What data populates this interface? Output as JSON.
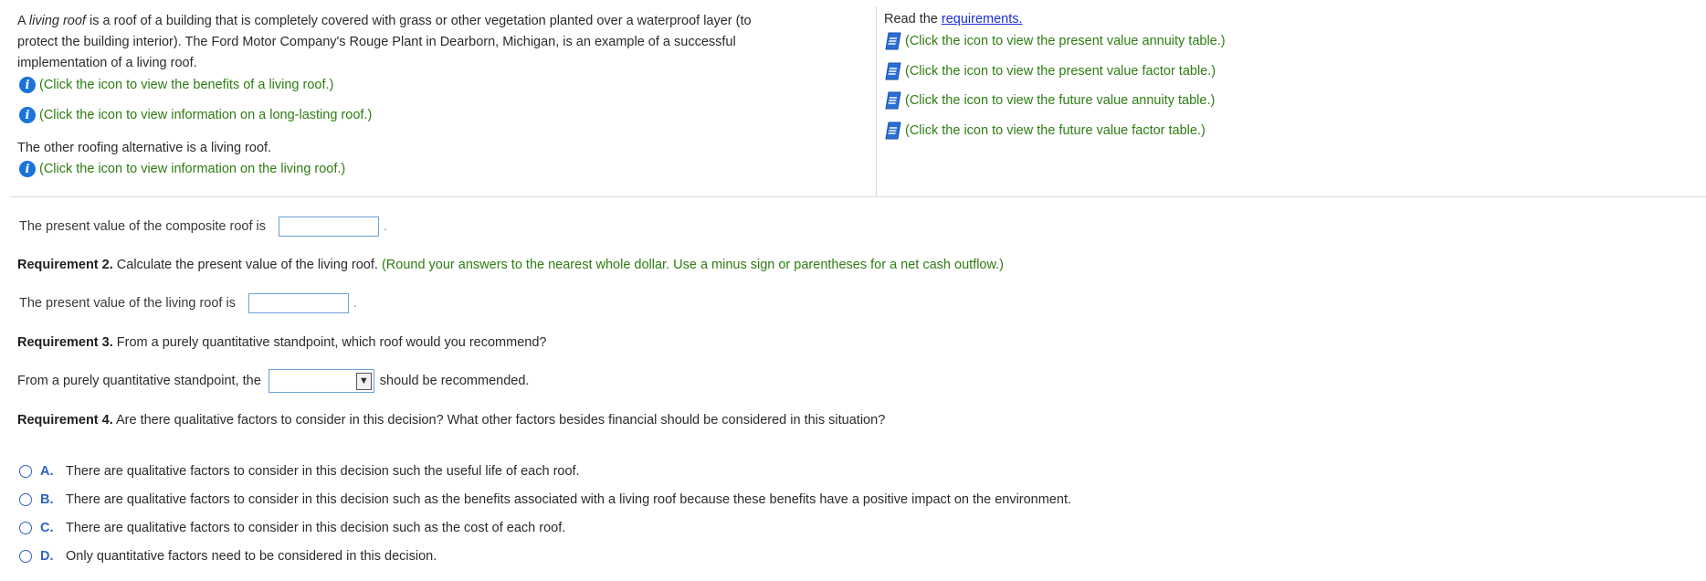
{
  "intro": {
    "prefix": "A ",
    "term": "living roof",
    "line1_rest": " is a roof of a building that is completely covered with grass or other vegetation planted over a waterproof layer (to",
    "line2": "protect the building interior). The Ford Motor Company's Rouge Plant in Dearborn, Michigan, is an example of a successful",
    "line3": "implementation of a living roof."
  },
  "info_links": [
    "(Click the icon to view the benefits of a living roof.)",
    "(Click the icon to view information on a long-lasting roof.)"
  ],
  "alternative_text": "The other roofing alternative is a living roof.",
  "living_roof_link": "(Click the icon to view information on the living roof.)",
  "right": {
    "read_prefix": "Read the ",
    "requirements_link": "requirements.",
    "tables": [
      "(Click the icon to view the present value annuity table.)",
      "(Click the icon to view the present value factor table.)",
      "(Click the icon to view the future value annuity table.)",
      "(Click the icon to view the future value factor table.)"
    ]
  },
  "q1": {
    "label": "The present value of the composite roof is",
    "value": "",
    "suffix": "."
  },
  "req2": {
    "bold": "Requirement 2.",
    "text": " Calculate the present value of the living roof. ",
    "hint": "(Round your answers to the nearest whole dollar. Use a minus sign or parentheses for a net cash outflow.)"
  },
  "q2": {
    "label": "The present value of the living roof is",
    "value": "",
    "suffix": "."
  },
  "req3": {
    "bold": "Requirement 3.",
    "text": " From a purely quantitative standpoint, which roof would you recommend?"
  },
  "q3": {
    "prefix": "From a purely quantitative standpoint, the",
    "selected": "",
    "suffix": "should be recommended."
  },
  "req4": {
    "bold": "Requirement 4.",
    "text": " Are there qualitative factors to consider in this decision? What other factors besides financial should be considered in this situation?"
  },
  "options": [
    {
      "letter": "A.",
      "text": "There are qualitative factors to consider in this decision such the useful life of each roof."
    },
    {
      "letter": "B.",
      "text": "There are qualitative factors to consider in this decision such as the benefits associated with a living roof because these benefits have a positive impact on the environment."
    },
    {
      "letter": "C.",
      "text": "There are qualitative factors to consider in this decision such as the cost of each roof."
    },
    {
      "letter": "D.",
      "text": "Only quantitative factors need to be considered in this decision."
    }
  ]
}
